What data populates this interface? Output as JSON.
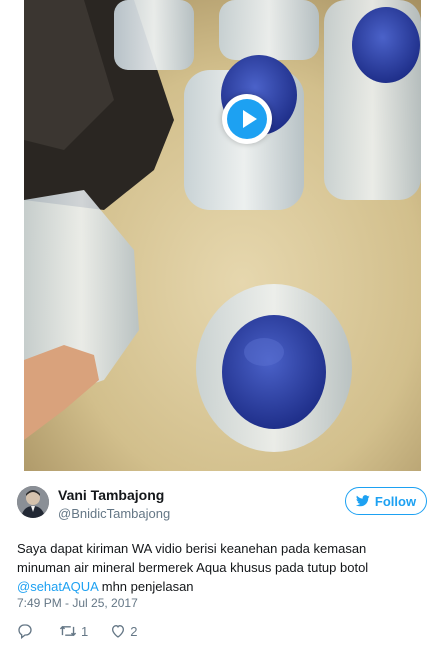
{
  "media": {
    "type": "video",
    "play_icon": "play-icon"
  },
  "author": {
    "display_name": "Vani Tambajong",
    "username": "@BnidicTambajong",
    "avatar_icon": "avatar"
  },
  "follow": {
    "label": "Follow",
    "icon": "twitter-bird-icon",
    "color": "#1da1f2"
  },
  "tweet": {
    "lines": [
      "Saya dapat kiriman WA vidio berisi keanehan pada kemasan",
      "minuman air mineral bermerek Aqua khusus pada tutup botol"
    ],
    "mention": "@sehatAQUA",
    "after_mention": " mhn penjelasan",
    "timestamp": "7:49 PM - Jul 25, 2017"
  },
  "actions": {
    "reply_icon": "reply-icon",
    "retweet_icon": "retweet-icon",
    "retweet_count": "1",
    "like_icon": "heart-icon",
    "like_count": "2"
  },
  "colors": {
    "accent": "#1da1f2",
    "secondary_text": "#657786",
    "primary_text": "#14171a"
  }
}
